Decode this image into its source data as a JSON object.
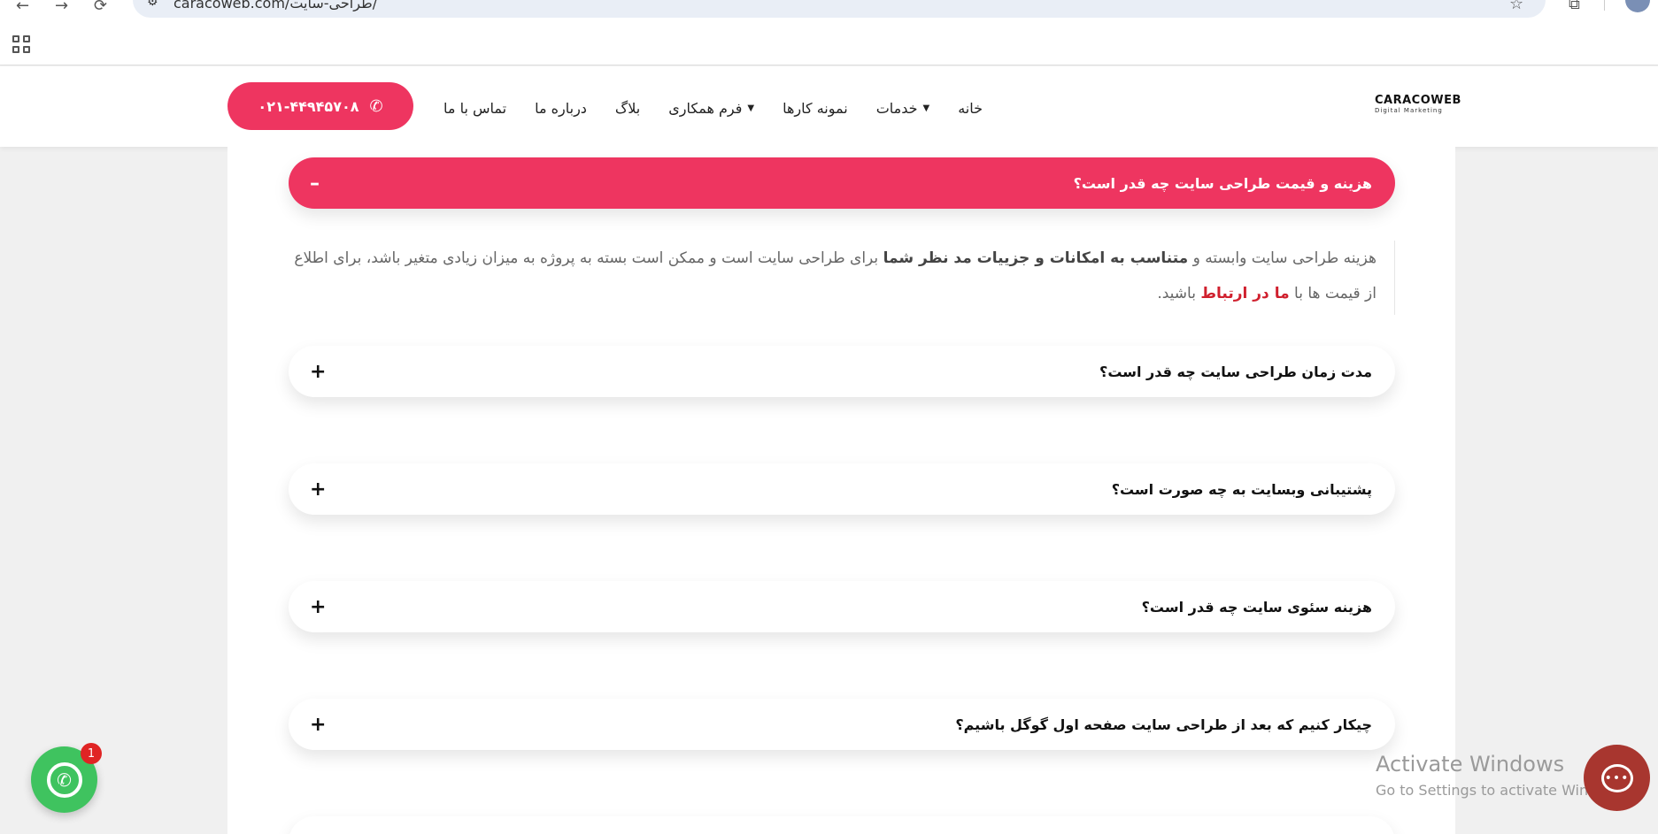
{
  "browser": {
    "url": "caracoweb.com/طراحی-سایت/",
    "back_icon": "←",
    "forward_icon": "→",
    "reload_icon": "⟳",
    "star_icon": "☆",
    "ext_icon": "⧉"
  },
  "header": {
    "phone": "۰۲۱-۴۴۹۴۵۷۰۸",
    "menu": [
      {
        "label": "خانه",
        "dropdown": false
      },
      {
        "label": "خدمات",
        "dropdown": true
      },
      {
        "label": "نمونه کارها",
        "dropdown": false
      },
      {
        "label": "فرم همکاری",
        "dropdown": true
      },
      {
        "label": "بلاگ",
        "dropdown": false
      },
      {
        "label": "درباره ما",
        "dropdown": false
      },
      {
        "label": "تماس با ما",
        "dropdown": false
      }
    ],
    "logo_main": "CARACOWEB",
    "logo_sub": "Digital Marketing"
  },
  "faq": {
    "open_item": {
      "title": "هزینه و قیمت طراحی سایت چه قدر است؟",
      "toggle": "–"
    },
    "answer": {
      "part1": "هزینه طراحی سایت وابسته و ",
      "bold1": "متناسب به امکانات و جزییات مد نظر شما",
      "part2": " برای طراحی سایت است و ممکن است بسته به پروژه به میزان زیادی متغیر باشد، برای اطلاع از قیمت ها با ",
      "link": "ما در ارتباط",
      "part3": " باشید."
    },
    "items": [
      {
        "title": "مدت زمان طراحی سایت چه قدر است؟",
        "toggle": "+"
      },
      {
        "title": "پشتیبانی وبسایت به چه صورت است؟",
        "toggle": "+"
      },
      {
        "title": "هزینه سئوی سایت چه قدر است؟",
        "toggle": "+"
      },
      {
        "title": "چیکار کنیم که بعد از طراحی سایت صفحه اول گوگل باشیم؟",
        "toggle": "+"
      }
    ]
  },
  "floating": {
    "whatsapp_badge": "1",
    "chat_icon": "•••"
  },
  "watermark": {
    "line1": "Activate Windows",
    "line2": "Go to Settings to activate Windows."
  },
  "colors": {
    "accent": "#ee3560",
    "whatsapp": "#3fc35f",
    "chat": "#a8362f"
  }
}
